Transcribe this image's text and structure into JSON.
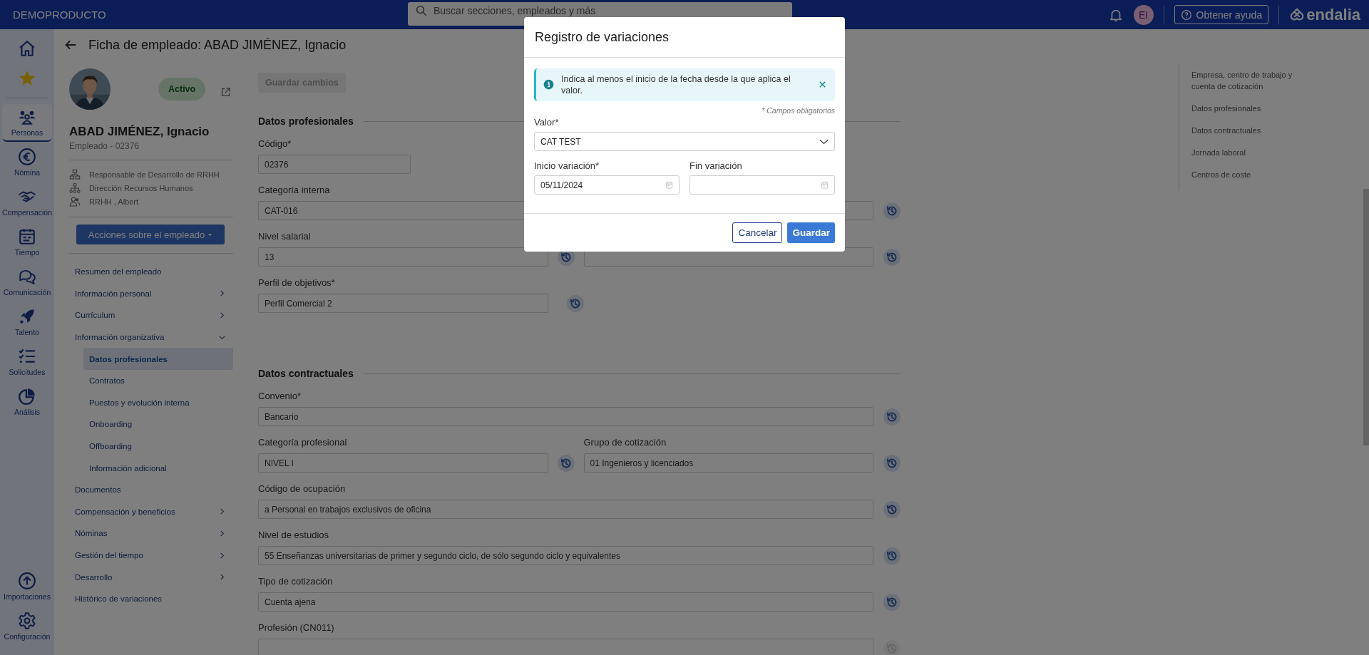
{
  "top_bar": {
    "brand": "DEMOPRODUCTO",
    "search": {
      "placeholder": "Buscar secciones, empleados y más"
    },
    "avatar": "EI",
    "help_button": "Obtener ayuda",
    "logo": "endalia"
  },
  "rail": {
    "top": [
      {
        "kind": "home",
        "selected": false
      },
      {
        "kind": "favorites",
        "selected": false
      }
    ],
    "main": [
      {
        "kind": "people",
        "label": "Personas",
        "selected": true
      },
      {
        "kind": "payroll",
        "label": "Nómina",
        "selected": false
      },
      {
        "kind": "compensation",
        "label": "Compensación",
        "selected": false
      },
      {
        "kind": "time",
        "label": "Tiempo",
        "selected": false
      },
      {
        "kind": "communication",
        "label": "Comunicación",
        "selected": false
      },
      {
        "kind": "talent",
        "label": "Talento",
        "selected": false
      },
      {
        "kind": "requests",
        "label": "Solicitudes",
        "selected": false
      },
      {
        "kind": "analysis",
        "label": "Análisis",
        "selected": false
      }
    ],
    "bottom": [
      {
        "kind": "imports",
        "label": "Importaciones",
        "selected": false
      },
      {
        "kind": "settings",
        "label": "Configuración",
        "selected": false
      }
    ]
  },
  "page_title": "Ficha de empleado: ABAD JIMÉNEZ, Ignacio",
  "employee": {
    "status": "Activo",
    "name": "ABAD JIMÉNEZ, Ignacio",
    "subtitle": "Empleado - 02376",
    "info": [
      {
        "kind": "position",
        "text": "Responsable de Desarrollo de RRHH"
      },
      {
        "kind": "department",
        "text": "Dirección Recursos Humanos"
      },
      {
        "kind": "manager",
        "text": "RRHH , Albert"
      }
    ],
    "actions_button": "Acciones sobre el empleado"
  },
  "nav": [
    {
      "label": "Resumen del empleado",
      "kind": "link",
      "selected": false
    },
    {
      "label": "Información personal",
      "kind": "group",
      "expanded": false,
      "selected": false
    },
    {
      "label": "Currículum",
      "kind": "group",
      "expanded": false,
      "selected": false
    },
    {
      "label": "Información organizativa",
      "kind": "group",
      "expanded": true,
      "selected": false,
      "children": [
        {
          "label": "Datos profesionales",
          "selected": true
        },
        {
          "label": "Contratos",
          "selected": false
        },
        {
          "label": "Puestos y evolución interna",
          "selected": false
        },
        {
          "label": "Onboarding",
          "selected": false
        },
        {
          "label": "Offboarding",
          "selected": false
        },
        {
          "label": "Información adicional",
          "selected": false
        }
      ]
    },
    {
      "label": "Documentos",
      "kind": "link",
      "selected": false
    },
    {
      "label": "Compensación y beneficios",
      "kind": "group",
      "expanded": false,
      "selected": false
    },
    {
      "label": "Nóminas",
      "kind": "group",
      "expanded": false,
      "selected": false
    },
    {
      "label": "Gestión del tiempo",
      "kind": "group",
      "expanded": false,
      "selected": false
    },
    {
      "label": "Desarrollo",
      "kind": "group",
      "expanded": false,
      "selected": false
    },
    {
      "label": "Histórico de variaciones",
      "kind": "link",
      "selected": false
    }
  ],
  "form": {
    "save_button": {
      "label": "Guardar cambios",
      "disabled": true
    },
    "sections": [
      {
        "title": "Datos profesionales",
        "rows": [
          [
            {
              "kind": "short",
              "label": "Código*",
              "value": "02376"
            }
          ],
          [
            {
              "kind": "full",
              "label": "Categoría interna",
              "value": "CAT-016",
              "history": {
                "disabled": false
              }
            }
          ],
          [
            {
              "kind": "half",
              "label": "Nivel salarial",
              "value": "13",
              "history": {
                "disabled": false
              }
            },
            {
              "kind": "half",
              "history": {
                "disabled": false
              }
            }
          ],
          [
            {
              "kind": "half",
              "label": "Perfil de objetivos*",
              "value": "Perfil Comercial 2",
              "history": {
                "disabled": false
              }
            }
          ]
        ]
      },
      {
        "title": "Datos contractuales",
        "rows": [
          [
            {
              "kind": "full",
              "label": "Convenio*",
              "value": "Bancario",
              "history": {
                "disabled": false
              }
            }
          ],
          [
            {
              "kind": "half",
              "label": "Categoría profesional",
              "value": "NIVEL I",
              "history": {
                "disabled": false
              }
            },
            {
              "kind": "half",
              "label": "Grupo de cotización",
              "value": "01 Ingenieros y licenciados",
              "history": {
                "disabled": false
              }
            }
          ],
          [
            {
              "kind": "full",
              "label": "Código de ocupación",
              "value": "a Personal en trabajos exclusivos de oficina",
              "history": {
                "disabled": false
              }
            }
          ],
          [
            {
              "kind": "full",
              "label": "Nivel de estudios",
              "value": "55 Enseñanzas universitarias de primer y segundo ciclo, de sólo segundo ciclo y equivalentes",
              "history": {
                "disabled": false
              }
            }
          ],
          [
            {
              "kind": "full",
              "label": "Tipo de cotización",
              "value": "Cuenta ajena",
              "history": {
                "disabled": false
              }
            }
          ],
          [
            {
              "kind": "full",
              "label": "Profesión (CN011)",
              "history": {
                "disabled": true
              }
            }
          ]
        ]
      }
    ]
  },
  "right_nav": [
    "Empresa, centro de trabajo y cuenta de cotización",
    "Datos profesionales",
    "Datos contractuales",
    "Jornada laboral",
    "Centros de coste"
  ],
  "modal": {
    "title": "Registro de variaciones",
    "alert": "Indica al menos el inicio de la fecha desde la que aplica el valor.",
    "required_note": "* Campos obligatorios",
    "value_field": {
      "label": "Valor*",
      "value": "CAT TEST"
    },
    "start_field": {
      "label": "Inicio variación*",
      "value": "05/11/2024"
    },
    "end_field": {
      "label": "Fin variación"
    },
    "buttons": [
      {
        "kind": "secondary",
        "label": "Cancelar"
      },
      {
        "kind": "primary",
        "label": "Guardar"
      }
    ]
  }
}
